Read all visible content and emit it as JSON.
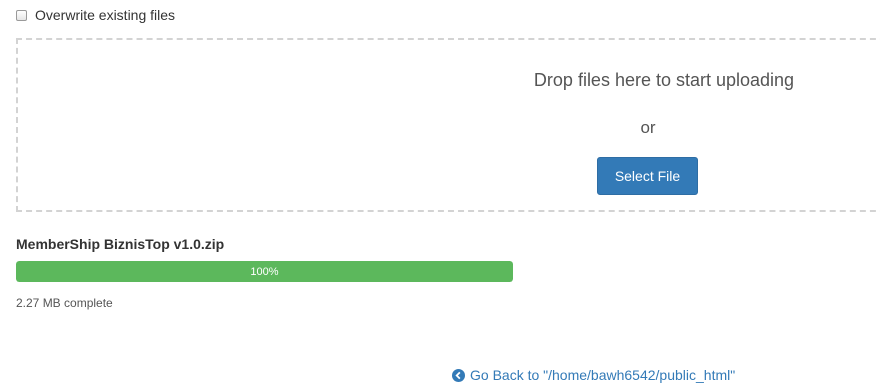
{
  "options": {
    "overwrite_label": "Overwrite existing files"
  },
  "dropzone": {
    "drop_text": "Drop files here to start uploading",
    "or_text": "or",
    "select_button_label": "Select File"
  },
  "upload": {
    "file_name": "MemberShip BiznisTop v1.0.zip",
    "progress_percent": 100,
    "progress_label": "100%",
    "size_text": "2.27 MB complete"
  },
  "footer": {
    "go_back_label": "Go Back to \"/home/bawh6542/public_html\"",
    "go_back_icon": "arrow-circle-left-icon"
  },
  "colors": {
    "accent": "#337ab7",
    "progress": "#5cb85c",
    "dropzone_border": "#d3d3d3"
  }
}
